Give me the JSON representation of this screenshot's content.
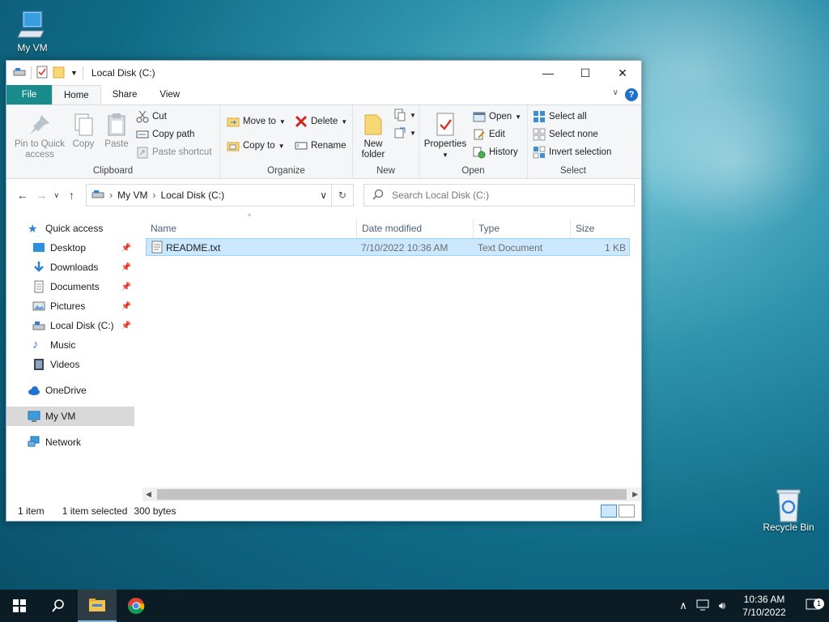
{
  "desktop": {
    "icons": [
      {
        "label": "My VM"
      },
      {
        "label": "Recycle Bin"
      }
    ]
  },
  "window": {
    "title": "Local Disk (C:)",
    "tabs": [
      {
        "label": "File"
      },
      {
        "label": "Home"
      },
      {
        "label": "Share"
      },
      {
        "label": "View"
      }
    ],
    "ribbon": {
      "clipboard": {
        "label": "Clipboard",
        "pin_to_quick_access": "Pin to Quick access",
        "copy": "Copy",
        "paste": "Paste",
        "cut": "Cut",
        "copy_path": "Copy path",
        "paste_shortcut": "Paste shortcut"
      },
      "organize": {
        "label": "Organize",
        "move_to": "Move to",
        "copy_to": "Copy to",
        "delete": "Delete",
        "rename": "Rename"
      },
      "new": {
        "label": "New",
        "new_folder": "New folder"
      },
      "open": {
        "label": "Open",
        "properties": "Properties",
        "open": "Open",
        "edit": "Edit",
        "history": "History"
      },
      "select": {
        "label": "Select",
        "select_all": "Select all",
        "select_none": "Select none",
        "invert_selection": "Invert selection"
      }
    },
    "address": {
      "crumbs": [
        "My VM",
        "Local Disk (C:)"
      ],
      "search_placeholder": "Search Local Disk (C:)"
    },
    "nav": {
      "quick_access": "Quick access",
      "items": [
        {
          "label": "Desktop"
        },
        {
          "label": "Downloads"
        },
        {
          "label": "Documents"
        },
        {
          "label": "Pictures"
        },
        {
          "label": "Local Disk (C:)"
        },
        {
          "label": "Music"
        },
        {
          "label": "Videos"
        }
      ],
      "onedrive": "OneDrive",
      "my_vm": "My VM",
      "network": "Network"
    },
    "columns": {
      "name": "Name",
      "date_modified": "Date modified",
      "type": "Type",
      "size": "Size"
    },
    "files": [
      {
        "name": "README.txt",
        "date": "7/10/2022 10:36 AM",
        "type": "Text Document",
        "size": "1 KB"
      }
    ],
    "status": {
      "count": "1 item",
      "selected": "1 item selected",
      "bytes": "300 bytes"
    }
  },
  "taskbar": {
    "time": "10:36 AM",
    "date": "7/10/2022",
    "notifications": "1"
  }
}
